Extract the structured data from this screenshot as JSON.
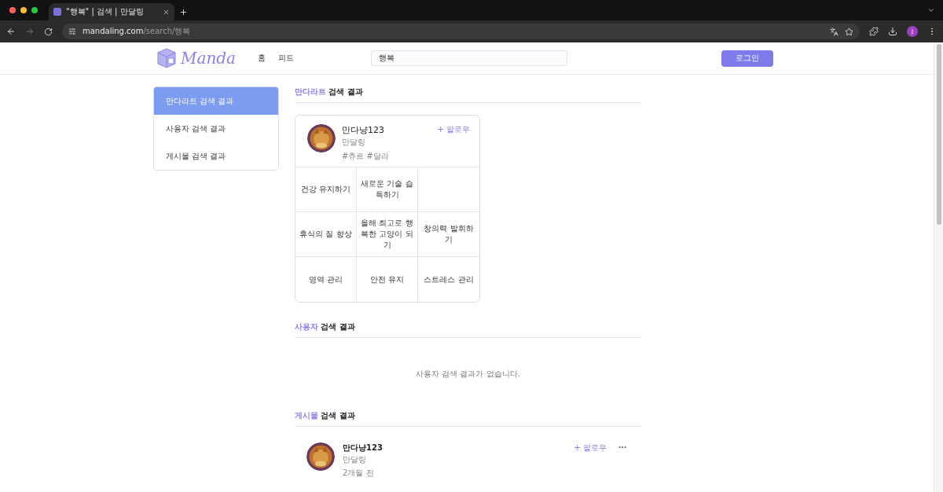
{
  "browser": {
    "tab_title": "\"행복\" | 검색 | 만달링",
    "url_host": "mandaling.com",
    "url_path": "/search/행복",
    "profile_initial": "J"
  },
  "header": {
    "logo_text": "Manda",
    "nav": [
      "홈",
      "피드"
    ],
    "search": {
      "value": "행복"
    },
    "login_button": "로그인"
  },
  "sidebar": {
    "items": [
      {
        "label": "만다라트 검색 결과",
        "selected": true
      },
      {
        "label": "사용자 검색 결과",
        "selected": false
      },
      {
        "label": "게시물 검색 결과",
        "selected": false
      }
    ]
  },
  "mandalart_section": {
    "title_highlight": "만다라트",
    "title_rest": "검색 결과",
    "card": {
      "user_name": "만다냥123",
      "user_sub": "만달링",
      "tags": "#츄르 #달라",
      "follow": "+ 팔로우",
      "cells": [
        "건강 유지하기",
        "새로운 기술 습득하기",
        null,
        "휴식의 질 향상",
        "올해 최고로 행복한 고양이 되기",
        "창의력 발휘하기",
        "영역 관리",
        "안전 유지",
        "스트레스 관리"
      ]
    }
  },
  "user_section": {
    "title_highlight": "사용자",
    "title_rest": "검색 결과",
    "empty_message": "사용자 검색 결과가 없습니다."
  },
  "post_section": {
    "title_highlight": "게시물",
    "title_rest": "검색 결과",
    "post": {
      "user_name": "만다냥123",
      "user_sub": "만달링",
      "time": "2개월 전",
      "follow": "+ 팔로우"
    }
  }
}
